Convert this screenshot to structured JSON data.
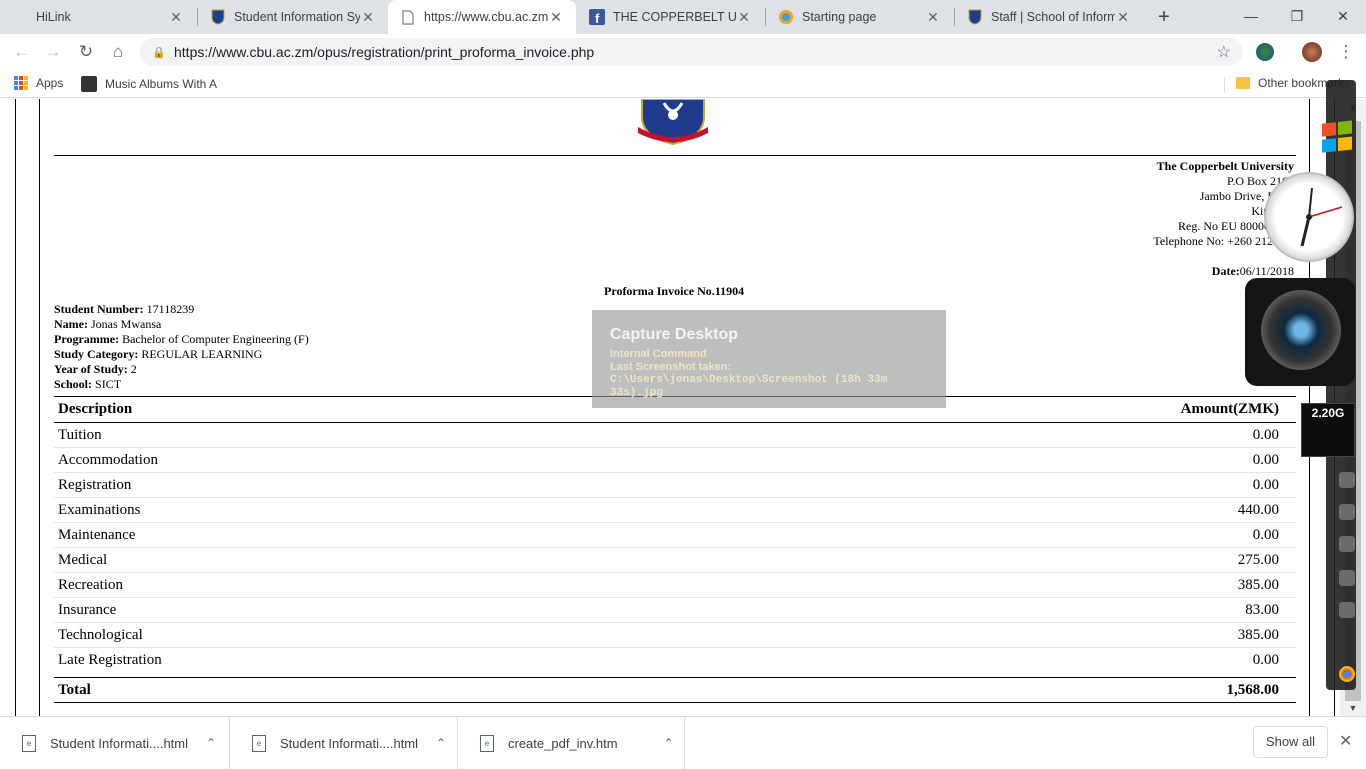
{
  "browser": {
    "tabs": [
      {
        "title": "HiLink",
        "favicon": "blank-icon",
        "active": false
      },
      {
        "title": "Student Information Sy",
        "favicon": "cbu-crest-icon",
        "active": false
      },
      {
        "title": "https://www.cbu.ac.zm/",
        "favicon": "page-icon",
        "active": true
      },
      {
        "title": "THE COPPERBELT UNIV",
        "favicon": "facebook-icon",
        "active": false
      },
      {
        "title": "Starting page",
        "favicon": "startpage-icon",
        "active": false
      },
      {
        "title": "Staff | School of Informa",
        "favicon": "cbu-crest-icon",
        "active": false
      }
    ],
    "new_tab_glyph": "+",
    "address": "https://www.cbu.ac.zm/opus/registration/print_proforma_invoice.php",
    "bookmarks": {
      "apps": "Apps",
      "music": "Music Albums With A",
      "other": "Other bookmarks"
    }
  },
  "invoice": {
    "university": "The Copperbelt University",
    "address_lines": [
      "P.O Box 2169",
      "Jambo Drive, River",
      "Kitwe, Z",
      "Reg. No EU 800000002",
      "Telephone No: +260 212 222"
    ],
    "date_label": "Date:",
    "date_value": "06/11/2018",
    "title": "Proforma Invoice No.11904",
    "student": {
      "number_label": "Student Number:",
      "number": "17118239",
      "name_label": "Name:",
      "name": "Jonas Mwansa",
      "programme_label": "Programme:",
      "programme": "Bachelor of Computer Engineering (F)",
      "category_label": "Study Category:",
      "category": "REGULAR LEARNING",
      "year_label": "Year of Study:",
      "year": "2",
      "school_label": "School:",
      "school": "SICT"
    },
    "table": {
      "header_description": "Description",
      "header_amount": "Amount(ZMK)",
      "rows": [
        {
          "description": "Tuition",
          "amount": "0.00"
        },
        {
          "description": "Accommodation",
          "amount": "0.00"
        },
        {
          "description": "Registration",
          "amount": "0.00"
        },
        {
          "description": "Examinations",
          "amount": "440.00"
        },
        {
          "description": "Maintenance",
          "amount": "0.00"
        },
        {
          "description": "Medical",
          "amount": "275.00"
        },
        {
          "description": "Recreation",
          "amount": "385.00"
        },
        {
          "description": "Insurance",
          "amount": "83.00"
        },
        {
          "description": "Technological",
          "amount": "385.00"
        },
        {
          "description": "Late Registration",
          "amount": "0.00"
        }
      ],
      "total_label": "Total",
      "total_amount": "1,568.00"
    }
  },
  "capture_overlay": {
    "title": "Capture Desktop",
    "line1": "Internal Command",
    "line2": "Last Screenshot taken:",
    "path": "C:\\Users\\jonas\\Desktop\\Screenshot (18h 33m 33s).jpg"
  },
  "gadgets": {
    "cpu_text": "2.20G"
  },
  "downloads": {
    "items": [
      "Student Informati....html",
      "Student Informati....html",
      "create_pdf_inv.htm"
    ],
    "show_all": "Show all"
  },
  "colors": {
    "tabstrip": "#dee1e6",
    "omnibox": "#f1f3f4",
    "overlay": "#969696",
    "overlay_text": "#efe5c3"
  }
}
